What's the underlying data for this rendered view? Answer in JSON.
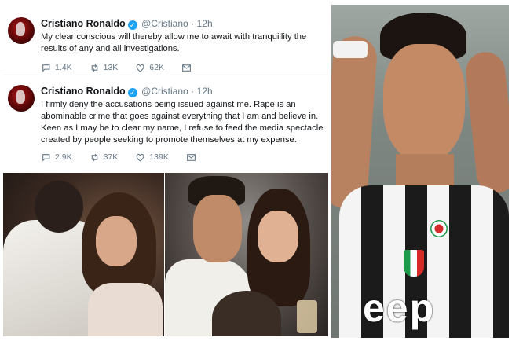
{
  "tweets": [
    {
      "name": "Cristiano Ronaldo",
      "handle": "@Cristiano",
      "separator": "·",
      "time": "12h",
      "text": "My clear conscious will thereby allow me to await with tranquillity the results of any and all investigations.",
      "replies": "1.4K",
      "retweets": "13K",
      "likes": "62K"
    },
    {
      "name": "Cristiano Ronaldo",
      "handle": "@Cristiano",
      "separator": "·",
      "time": "12h",
      "text": "I firmly deny the accusations being issued against me. Rape is an abominable crime that goes against everything that I am and believe in. Keen as I may be to clear my name, I refuse to feed the media spectacle created by people seeking to promote themselves at my expense.",
      "replies": "2.9K",
      "retweets": "37K",
      "likes": "139K"
    }
  ],
  "icons": {
    "verified": "verified-badge-icon",
    "reply": "reply-icon",
    "retweet": "retweet-icon",
    "like": "heart-icon",
    "dm": "envelope-icon"
  },
  "photos": {
    "right_jersey_text": "eep"
  },
  "colors": {
    "twitter_blue": "#1da1f2",
    "muted": "#657786",
    "text": "#14171a"
  }
}
